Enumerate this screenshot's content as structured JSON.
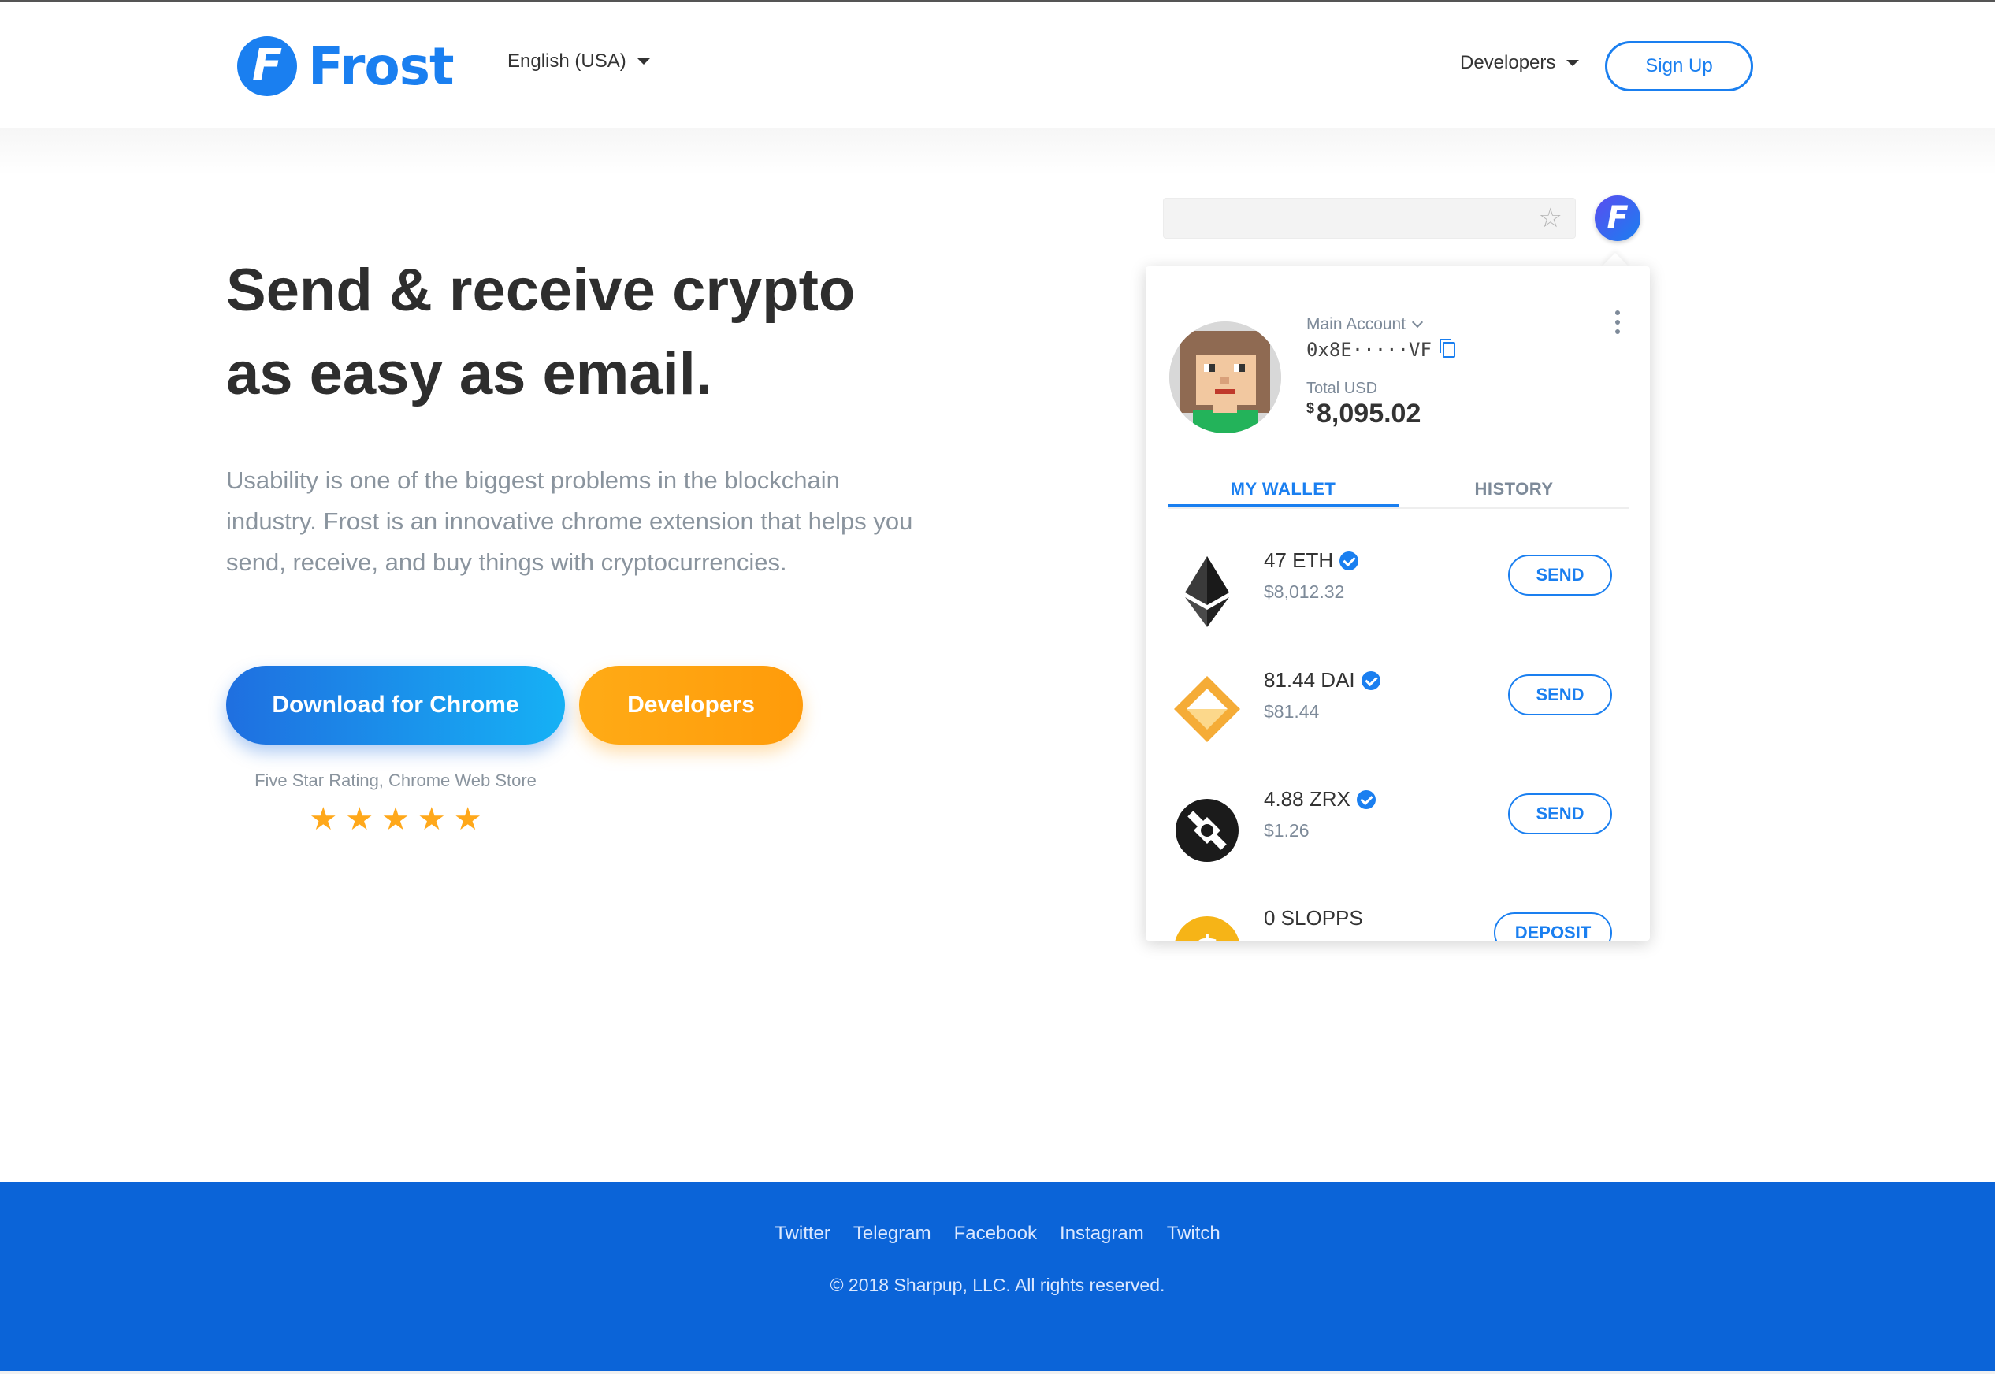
{
  "header": {
    "brand": "Frost",
    "brand_letter": "F",
    "language": "English (USA)",
    "developers_label": "Developers",
    "signup_label": "Sign Up"
  },
  "hero": {
    "headline_line1": "Send & receive crypto",
    "headline_line2": "as easy as email.",
    "description": "Usability is one of the biggest problems in the blockchain industry. Frost is an innovative chrome extension that helps you send, receive, and buy things with cryptocurrencies.",
    "download_button": "Download for Chrome",
    "developers_button": "Developers",
    "rating_text": "Five Star Rating, Chrome Web Store",
    "rating_stars": 5
  },
  "wallet": {
    "account_label": "Main Account",
    "address": "0x8E·····VF",
    "total_label": "Total USD",
    "total_currency": "$",
    "total_value": "8,095.02",
    "tabs": [
      "MY WALLET",
      "HISTORY"
    ],
    "active_tab": "MY WALLET",
    "assets": [
      {
        "amount": "47 ETH",
        "usd": "$8,012.32",
        "action": "SEND",
        "icon": "ethereum-icon",
        "verified": true
      },
      {
        "amount": "81.44 DAI",
        "usd": "$81.44",
        "action": "SEND",
        "icon": "dai-icon",
        "verified": true
      },
      {
        "amount": "4.88 ZRX",
        "usd": "$1.26",
        "action": "SEND",
        "icon": "zrx-icon",
        "verified": true
      },
      {
        "amount": "0 SLOPPS",
        "usd": "",
        "action": "DEPOSIT",
        "icon": "slopps-icon",
        "verified": false
      }
    ]
  },
  "footer": {
    "links": [
      "Twitter",
      "Telegram",
      "Facebook",
      "Instagram",
      "Twitch"
    ],
    "copyright": "© 2018 Sharpup, LLC. All rights reserved."
  },
  "colors": {
    "brand_blue": "#1a7ff0",
    "accent_orange": "#ffa81a",
    "footer_blue": "#0b64d8",
    "text_muted": "#8a949e"
  }
}
